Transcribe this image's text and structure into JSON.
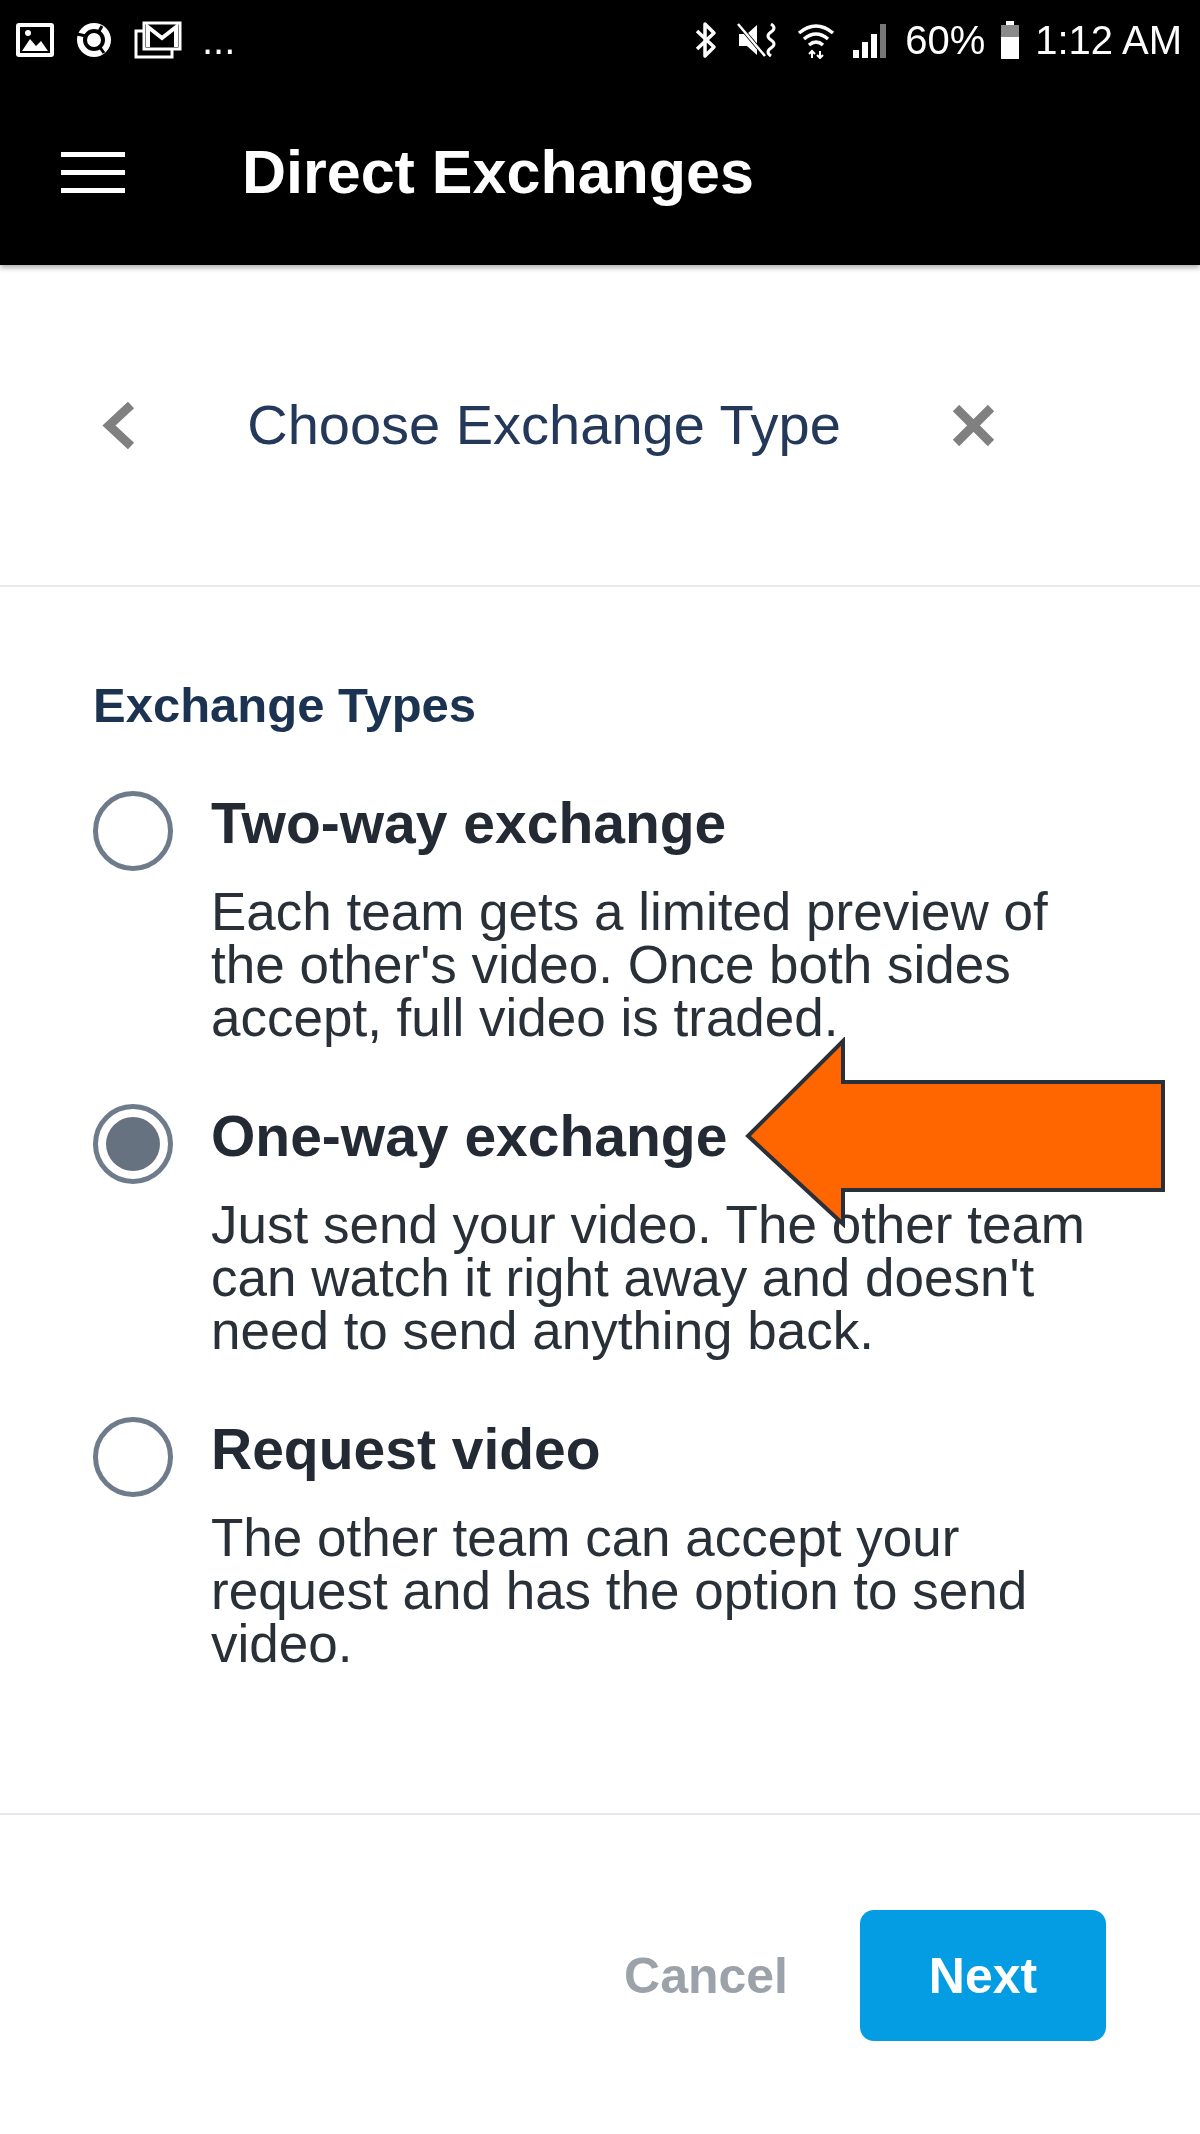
{
  "status_bar": {
    "more_notifications": "...",
    "battery": "60%",
    "time": "1:12 AM"
  },
  "app_bar": {
    "title": "Direct Exchanges"
  },
  "dialog": {
    "title": "Choose Exchange Type",
    "section_title": "Exchange Types",
    "options": [
      {
        "label": "Two-way exchange",
        "description": "Each team gets a limited preview of the other's video. Once both sides accept, full video is traded.",
        "selected": false,
        "arrow": false
      },
      {
        "label": "One-way exchange",
        "description": "Just send your video. The other team can watch it right away and doesn't need to send anything back.",
        "selected": true,
        "arrow": true
      },
      {
        "label": "Request video",
        "description": "The other team can accept your request and has the option to send video.",
        "selected": false,
        "arrow": false
      }
    ],
    "buttons": [
      {
        "label": "Cancel",
        "kind": "secondary"
      },
      {
        "label": "Next",
        "kind": "primary"
      }
    ]
  }
}
